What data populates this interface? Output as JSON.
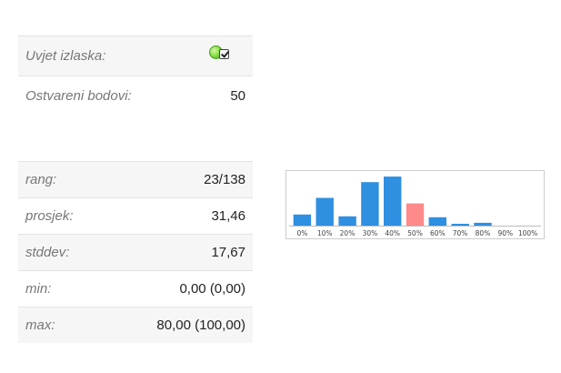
{
  "summary": {
    "rows": [
      {
        "label": "Uvjet izlaska:",
        "value": "",
        "status": "passed",
        "checked": true
      },
      {
        "label": "Ostvareni bodovi:",
        "value": "50"
      }
    ]
  },
  "stats": {
    "rows": [
      {
        "label": "rang:",
        "value": "23/138"
      },
      {
        "label": "prosjek:",
        "value": "31,46"
      },
      {
        "label": "stddev:",
        "value": "17,67"
      },
      {
        "label": "min:",
        "value": "0,00 (0,00)"
      },
      {
        "label": "max:",
        "value": "80,00 (100,00)"
      }
    ]
  },
  "chart_data": {
    "type": "bar",
    "title": "",
    "xlabel": "",
    "ylabel": "",
    "categories": [
      "0%",
      "10%",
      "20%",
      "30%",
      "40%",
      "50%",
      "60%",
      "70%",
      "80%",
      "90%",
      "100%"
    ],
    "values": [
      12,
      30,
      10,
      47,
      53,
      24,
      9,
      2,
      3,
      0,
      0
    ],
    "highlight_index": 5,
    "ylim": [
      0,
      56
    ],
    "grid": false,
    "colors": {
      "bar": "#2f8fe0",
      "highlight": "#ff8a8a",
      "axis": "#bbbbbb",
      "tick_label": "#444444"
    }
  }
}
